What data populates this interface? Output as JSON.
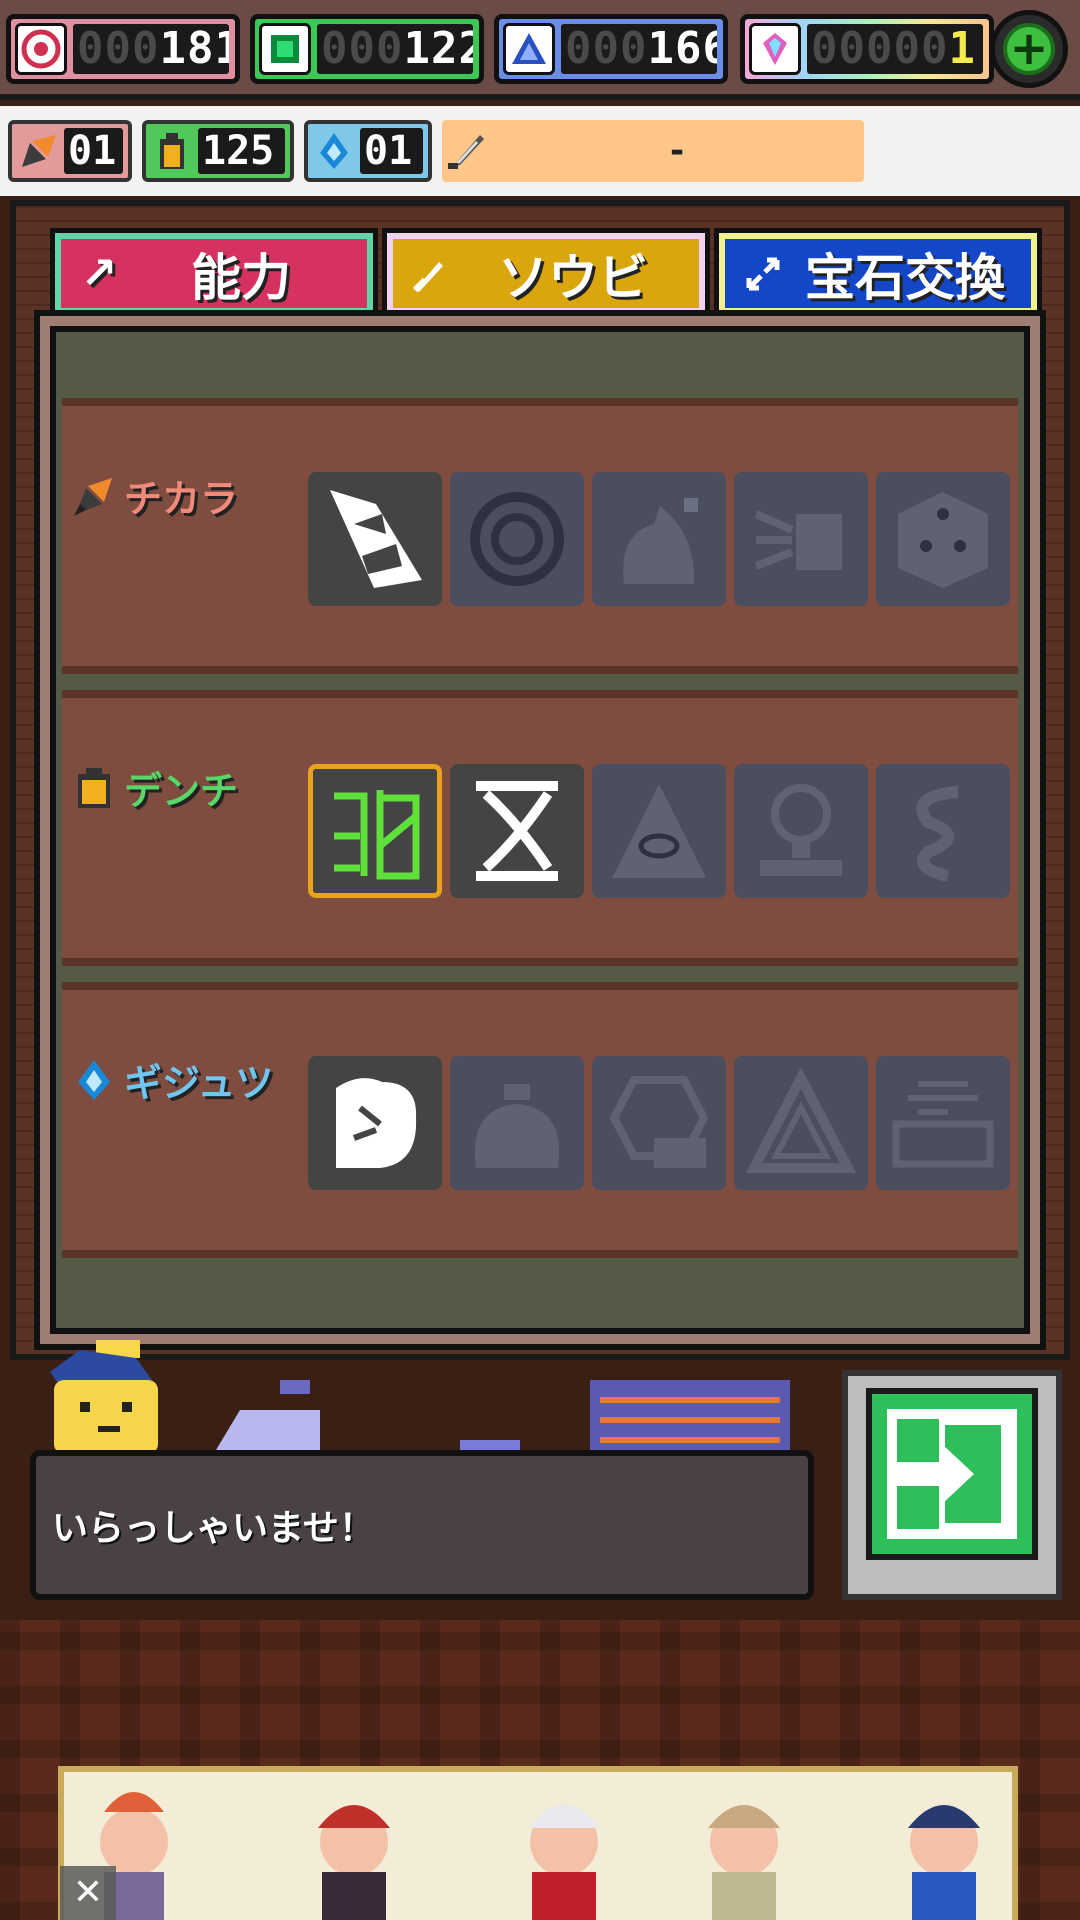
{
  "resources": {
    "red": {
      "zeros": "000",
      "value": "181",
      "icon": "target-icon",
      "color": "#e08fa0"
    },
    "green": {
      "zeros": "000",
      "value": "122",
      "icon": "green-gem-icon",
      "color": "#3cc857"
    },
    "blue": {
      "zeros": "000",
      "value": "166",
      "icon": "triangle-gem-icon",
      "color": "#6a8ee8"
    },
    "rainbow": {
      "zeros": "00000",
      "value": "1",
      "icon": "diamond-icon"
    },
    "add_label": "+"
  },
  "stats": {
    "power": "01",
    "battery": "125",
    "tech": "01",
    "weapon": "-"
  },
  "tabs": [
    {
      "label": "能力",
      "icon": "arrow-up-right-icon",
      "color": "#d6325f"
    },
    {
      "label": "ソウビ",
      "icon": "sword-icon",
      "color": "#d9a60e"
    },
    {
      "label": "宝石交換",
      "icon": "exchange-icon",
      "color": "#1446c8"
    }
  ],
  "rows": [
    {
      "label": "チカラ",
      "label_color": "#f08a7a",
      "icon": "drill-icon"
    },
    {
      "label": "デンチ",
      "label_color": "#58d66a",
      "icon": "battery-icon"
    },
    {
      "label": "ギジュツ",
      "label_color": "#6fc6f2",
      "icon": "water-drop-icon"
    }
  ],
  "dialog": {
    "text": "いらっしゃいませ！"
  },
  "ad": {
    "close_label": "✕"
  }
}
